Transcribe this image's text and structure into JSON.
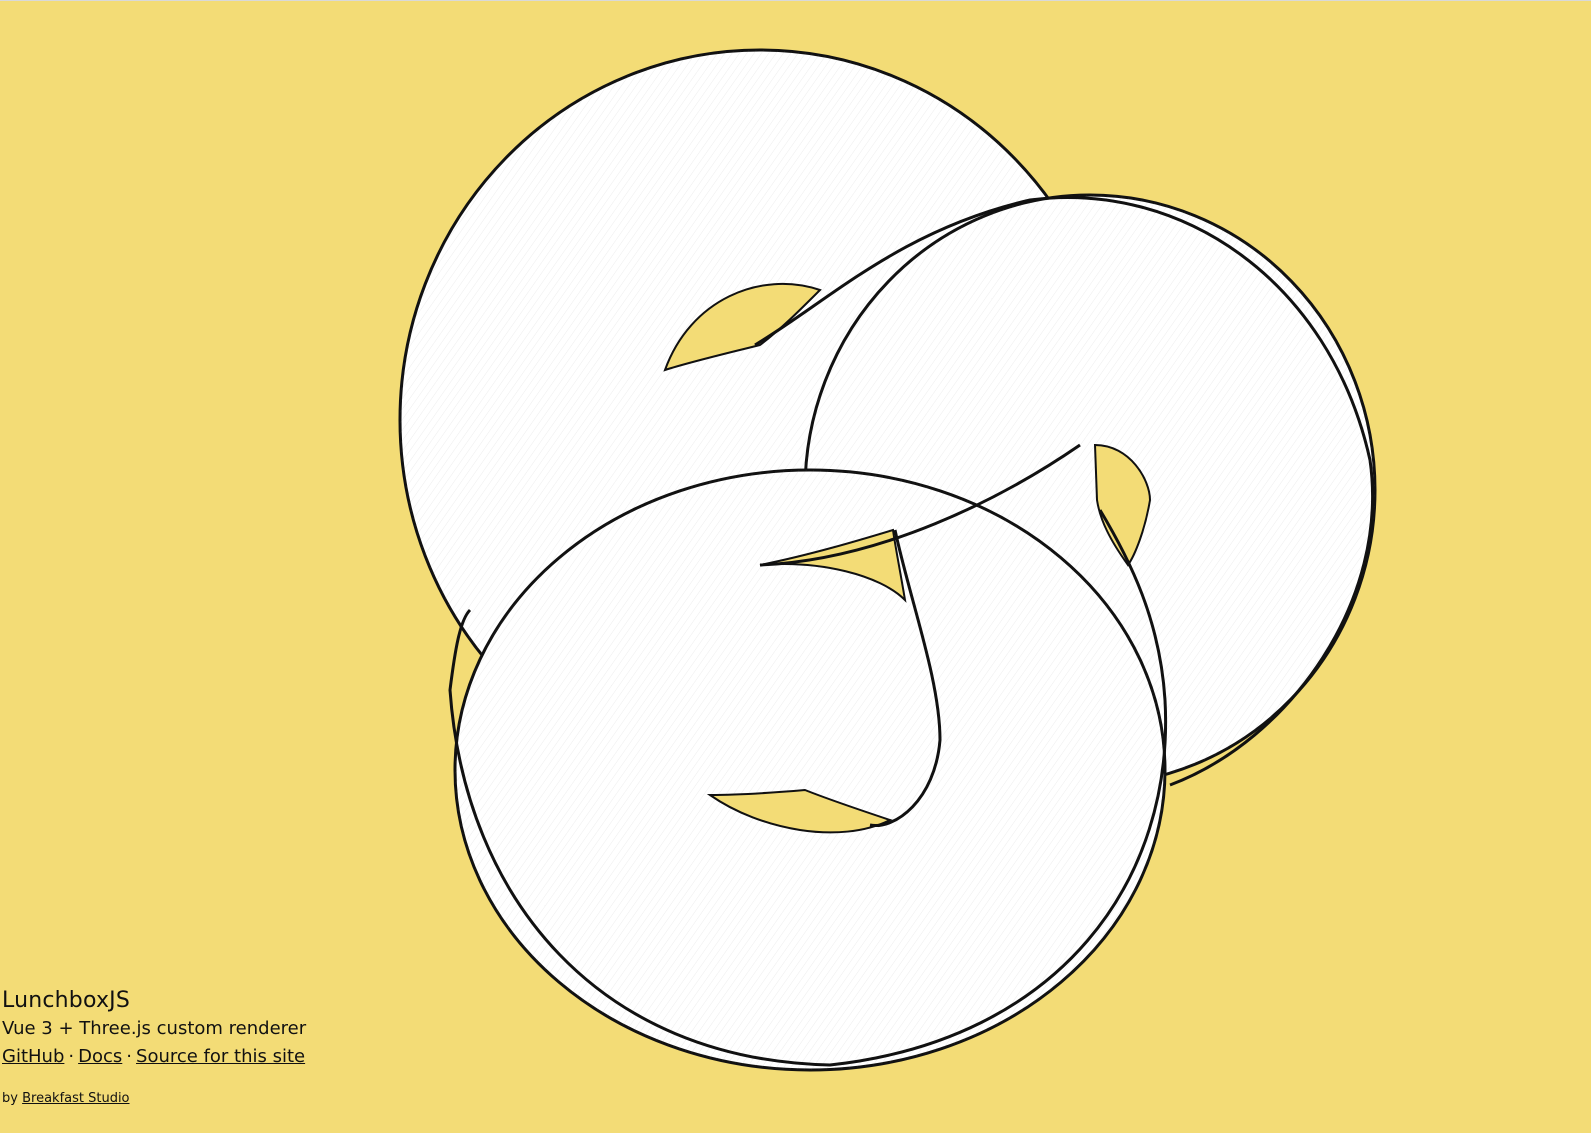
{
  "colors": {
    "background": "#f3dc76",
    "knot_fill": "#ffffff",
    "knot_outline": "#111111"
  },
  "scene": {
    "icon": "trefoil-knot-render"
  },
  "info": {
    "title": "LunchboxJS",
    "subtitle": "Vue 3 + Three.js custom renderer",
    "links": {
      "github": "GitHub",
      "docs": "Docs",
      "source": "Source for this site",
      "separator": "·"
    }
  },
  "byline": {
    "prefix": "by",
    "studio": "Breakfast Studio"
  }
}
